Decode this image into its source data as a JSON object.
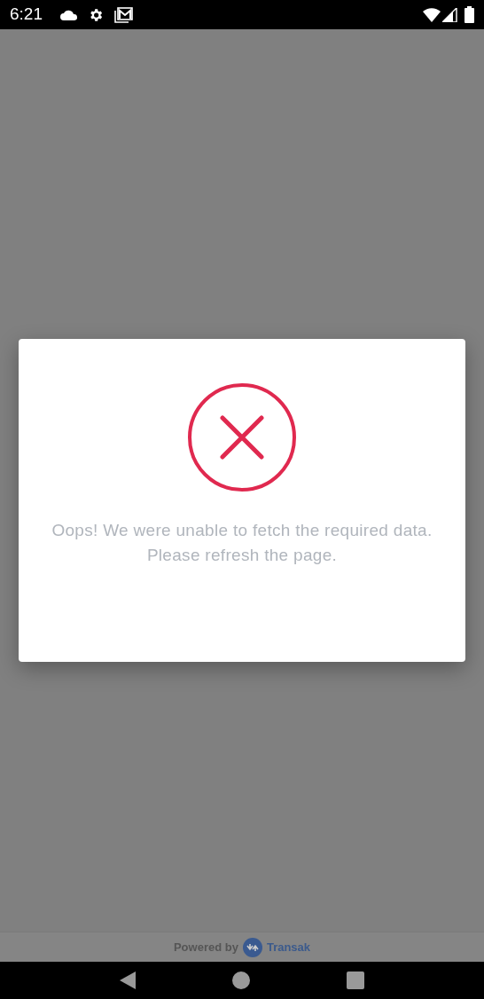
{
  "status_bar": {
    "time": "6:21"
  },
  "dialog": {
    "message": "Oops! We were unable to fetch the required data. Please refresh the page."
  },
  "footer": {
    "powered_by": "Powered by",
    "brand": "Transak"
  }
}
